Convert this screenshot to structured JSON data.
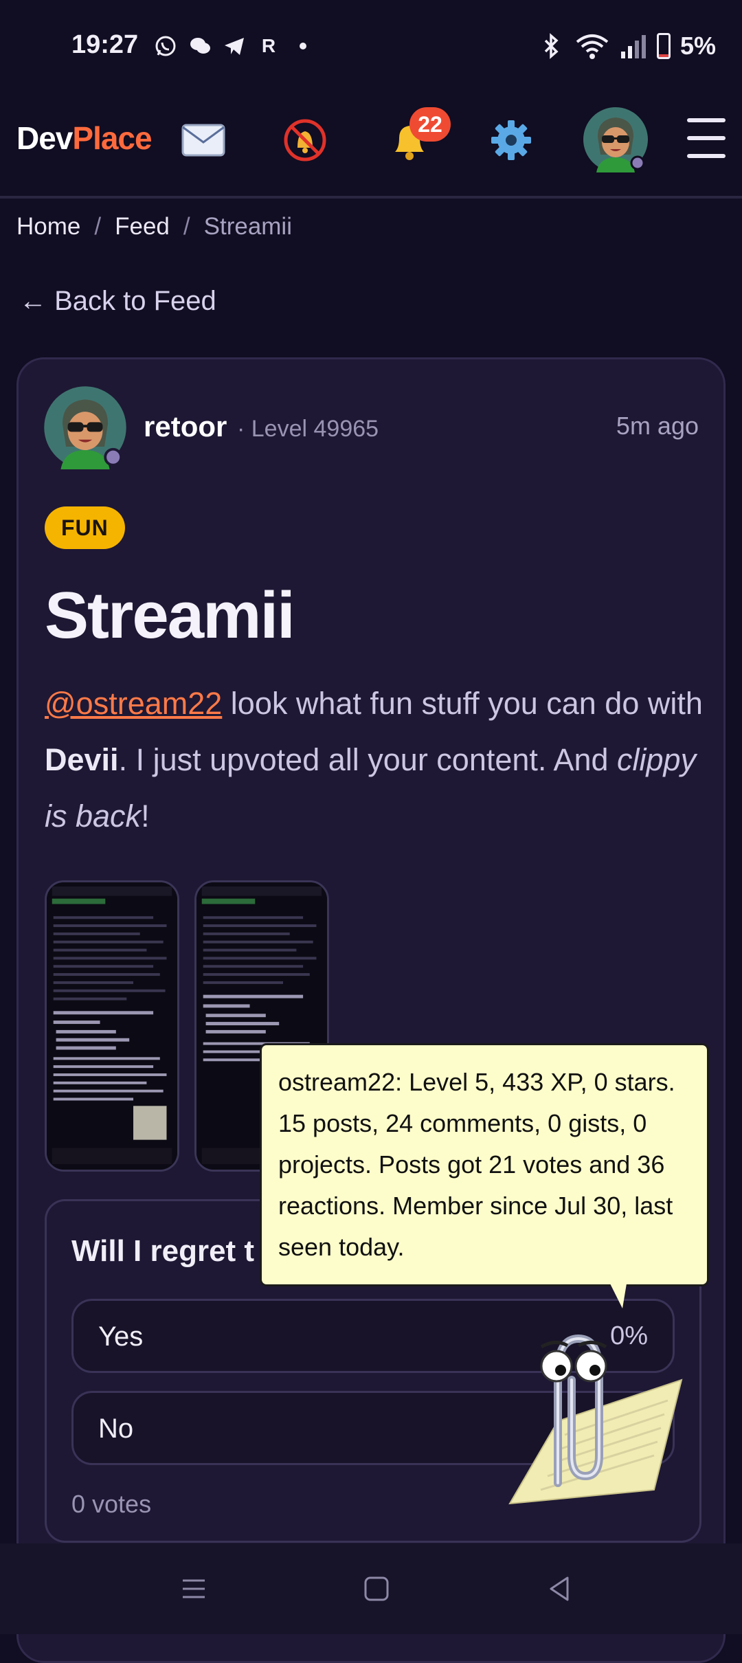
{
  "status_bar": {
    "time": "19:27",
    "app_r": "R",
    "battery": "5%",
    "battery_level": 0.05
  },
  "header": {
    "logo_dev": "Dev",
    "logo_place": "Place",
    "notification_count": "22",
    "icons": [
      "mail-icon",
      "muted-bell-icon",
      "bell-icon",
      "gear-icon",
      "avatar",
      "hamburger-menu-icon"
    ]
  },
  "breadcrumb": {
    "home": "Home",
    "sep": "/",
    "feed": "Feed",
    "current": "Streamii"
  },
  "back_link": "← Back to Feed",
  "post": {
    "author": "retoor",
    "level": "· Level 49965",
    "time": "5m ago",
    "tag": "FUN",
    "title": "Streamii",
    "body": {
      "mention": "@ostream22",
      "t1": " look what fun stuff you can do with ",
      "bold": "Devii",
      "t2": ". I just upvoted all your content. And ",
      "italic": "clippy is back",
      "t3": "!"
    }
  },
  "poll": {
    "question": "Will I regret t",
    "options": [
      {
        "label": "Yes",
        "percent": "0%"
      },
      {
        "label": "No",
        "percent": ""
      }
    ],
    "votes": "0 votes"
  },
  "tooltip": "ostream22: Level 5, 433 XP, 0 stars. 15 posts, 24 comments, 0 gists, 0 projects. Posts got 21 votes and 36 reactions. Member since Jul 30, last seen today.",
  "colors": {
    "accent": "#ff6a3d",
    "tag": "#f5b400",
    "badge": "#ef4b32",
    "tooltip_bg": "#fdfdcb"
  }
}
